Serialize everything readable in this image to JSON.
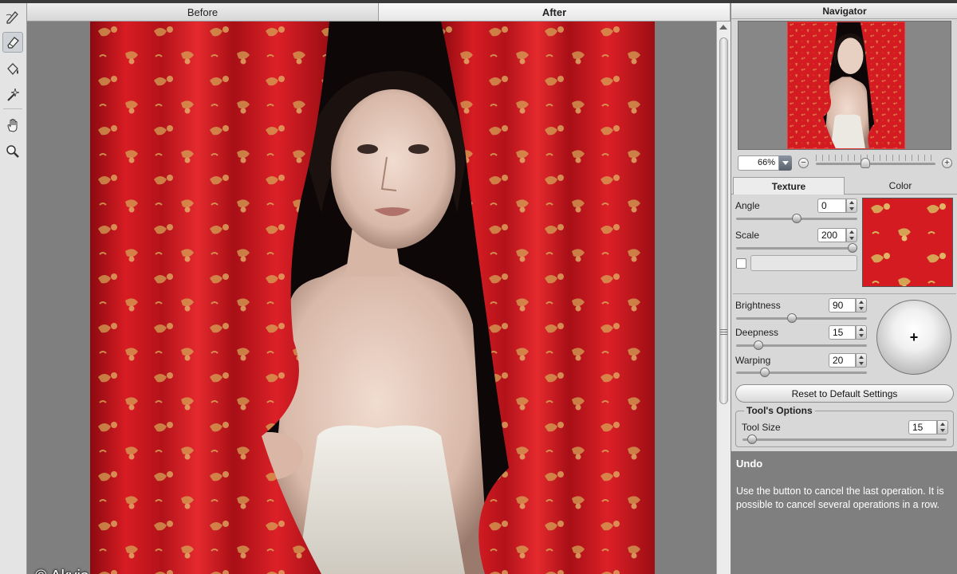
{
  "toolbar": {
    "tools": [
      {
        "name": "texture-brush-tool",
        "icon": "pencil-stroke-icon"
      },
      {
        "name": "eraser-tool",
        "icon": "eraser-icon"
      },
      {
        "name": "fill-tool",
        "icon": "bucket-icon"
      },
      {
        "name": "magic-wand-tool",
        "icon": "magic-wand-icon"
      },
      {
        "name": "hand-tool",
        "icon": "hand-icon"
      },
      {
        "name": "zoom-tool",
        "icon": "magnifier-icon"
      }
    ],
    "active_tool": "eraser-tool"
  },
  "view_tabs": {
    "before": "Before",
    "after": "After",
    "active": "After"
  },
  "canvas": {
    "watermark": "© Akvis"
  },
  "navigator": {
    "title": "Navigator",
    "zoom_value": "66%",
    "zoom_out_label": "−",
    "zoom_in_label": "+",
    "zoom_level": 0.66
  },
  "panel_tabs": {
    "texture": "Texture",
    "color": "Color",
    "active": "Texture"
  },
  "texture": {
    "angle_label": "Angle",
    "angle_value": "0",
    "scale_label": "Scale",
    "scale_value": "200"
  },
  "relief": {
    "brightness_label": "Brightness",
    "brightness_value": "90",
    "deepness_label": "Deepness",
    "deepness_value": "15",
    "warping_label": "Warping",
    "warping_value": "20",
    "light_marker": "+"
  },
  "reset_button": "Reset to Default Settings",
  "tool_options": {
    "title": "Tool's Options",
    "size_label": "Tool Size",
    "size_value": "15"
  },
  "help": {
    "title": "Undo",
    "text": "Use the button to cancel the last operation. It is possible to cancel several operations in a row."
  },
  "colors": {
    "curtain_red": "#d51b22",
    "gold_pattern": "#d9b55a",
    "canvas_gray": "#7f7f7f",
    "help_bg": "#7f7f7f"
  }
}
